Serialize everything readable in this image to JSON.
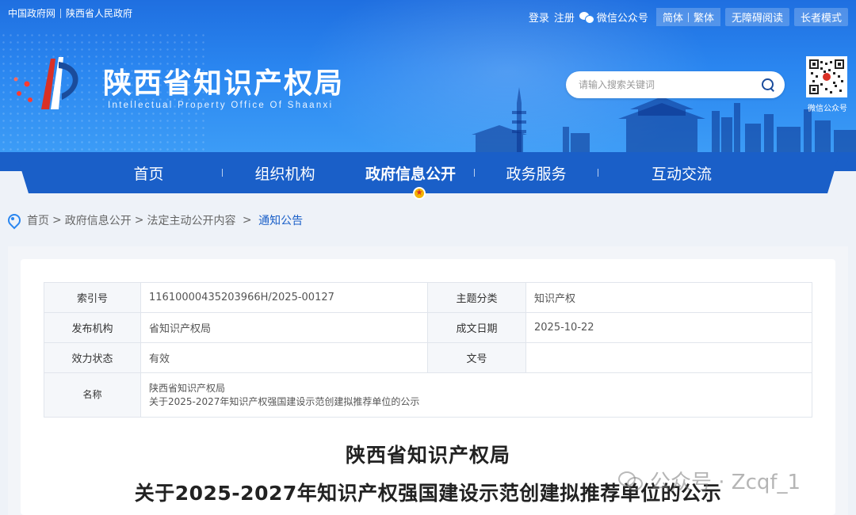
{
  "topbar": {
    "links_left": [
      "中国政府网",
      "陕西省人民政府"
    ],
    "login": "登录",
    "register": "注册",
    "wechat": "微信公众号",
    "simplified": "简体",
    "traditional": "繁体",
    "accessible": "无障碍阅读",
    "elder_mode": "长者模式"
  },
  "header": {
    "title": "陕西省知识产权局",
    "subtitle": "Intellectual Property Office Of Shaanxi",
    "search_placeholder": "请输入搜索关键词",
    "qr_caption": "微信公众号"
  },
  "nav": {
    "items": [
      "首页",
      "组织机构",
      "政府信息公开",
      "政务服务",
      "互动交流"
    ],
    "active_index": 2
  },
  "breadcrumb": {
    "items": [
      "首页",
      "政府信息公开",
      "法定主动公开内容",
      "通知公告"
    ],
    "separators": [
      ">",
      ">",
      " > "
    ]
  },
  "meta": {
    "index_label": "索引号",
    "index_value": "11610000435203966H/2025-00127",
    "topic_label": "主题分类",
    "topic_value": "知识产权",
    "publisher_label": "发布机构",
    "publisher_value": "省知识产权局",
    "date_label": "成文日期",
    "date_value": "2025-10-22",
    "status_label": "效力状态",
    "status_value": "有效",
    "docno_label": "文号",
    "docno_value": "",
    "name_label": "名称",
    "name_line1": "陕西省知识产权局",
    "name_line2": "关于2025-2027年知识产权强国建设示范创建拟推荐单位的公示"
  },
  "document": {
    "title_line1": "陕西省知识产权局",
    "title_line2": "关于2025-2027年知识产权强国建设示范创建拟推荐单位的公示"
  },
  "watermark": {
    "text": "公众号 · Zcqf_1"
  },
  "colors": {
    "banner": "#2a86f0",
    "nav": "#1a5fc8",
    "accent_star": "#f4b400"
  }
}
